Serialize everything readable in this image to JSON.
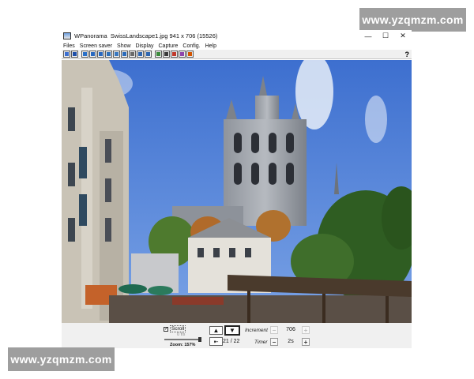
{
  "watermarks": {
    "top": "www.yzqmzm.com",
    "bottom": "www.yzqmzm.com"
  },
  "window": {
    "app_name": "WPanorama",
    "file_info": "SwissLandscape1.jpg  941 x 706 (15526)",
    "controls": {
      "minimize": "—",
      "maximize": "☐",
      "close": "✕"
    }
  },
  "menu": {
    "items": [
      {
        "label": "Files"
      },
      {
        "label": "Screen saver"
      },
      {
        "label": "Show"
      },
      {
        "label": "Display"
      },
      {
        "label": "Capture"
      },
      {
        "label": "Config."
      },
      {
        "label": "Help"
      }
    ]
  },
  "toolbar": {
    "help_label": "?",
    "buttons": [
      {
        "icon": "open-icon",
        "color": "#3b6fd1"
      },
      {
        "icon": "save-icon",
        "color": "#1f4fa8"
      },
      {
        "icon": "scroll-left-icon",
        "color": "#2a70c8"
      },
      {
        "icon": "arrows-icon",
        "color": "#2868c0"
      },
      {
        "icon": "arrows-cross-icon",
        "color": "#2868c0"
      },
      {
        "icon": "rotate-icon",
        "color": "#3070b8"
      },
      {
        "icon": "flip-icon",
        "color": "#3a78c0"
      },
      {
        "icon": "move-icon",
        "color": "#2a6aba"
      },
      {
        "icon": "grid-icon",
        "color": "#6a6a6a"
      },
      {
        "icon": "zoom-icon",
        "color": "#2e66b0"
      },
      {
        "icon": "fit-icon",
        "color": "#2e66b0"
      },
      {
        "icon": "landscape-icon",
        "color": "#3c8a3c"
      },
      {
        "icon": "sound-icon",
        "color": "#3a3a3a"
      },
      {
        "icon": "palette-icon",
        "color": "#c0392b"
      },
      {
        "icon": "settings-icon",
        "color": "#8e44ad"
      },
      {
        "icon": "record-icon",
        "color": "#d35400"
      }
    ]
  },
  "photo": {
    "description_alt": "Panoramic photo"
  },
  "status": {
    "scroll_label": "Scroll",
    "scroll_checked": true,
    "fps": "0 f/s",
    "zoom": "Zoom: 157%",
    "page_current": "21",
    "page_sep": "/",
    "page_total": "22",
    "increment_label": "Increment",
    "increment_value": "706",
    "timer_label": "Timer",
    "timer_value": "2s",
    "up_symbol": "▲",
    "down_symbol": "▼",
    "first_symbol": "⇤",
    "minus_symbol": "−",
    "plus_symbol": "+"
  }
}
